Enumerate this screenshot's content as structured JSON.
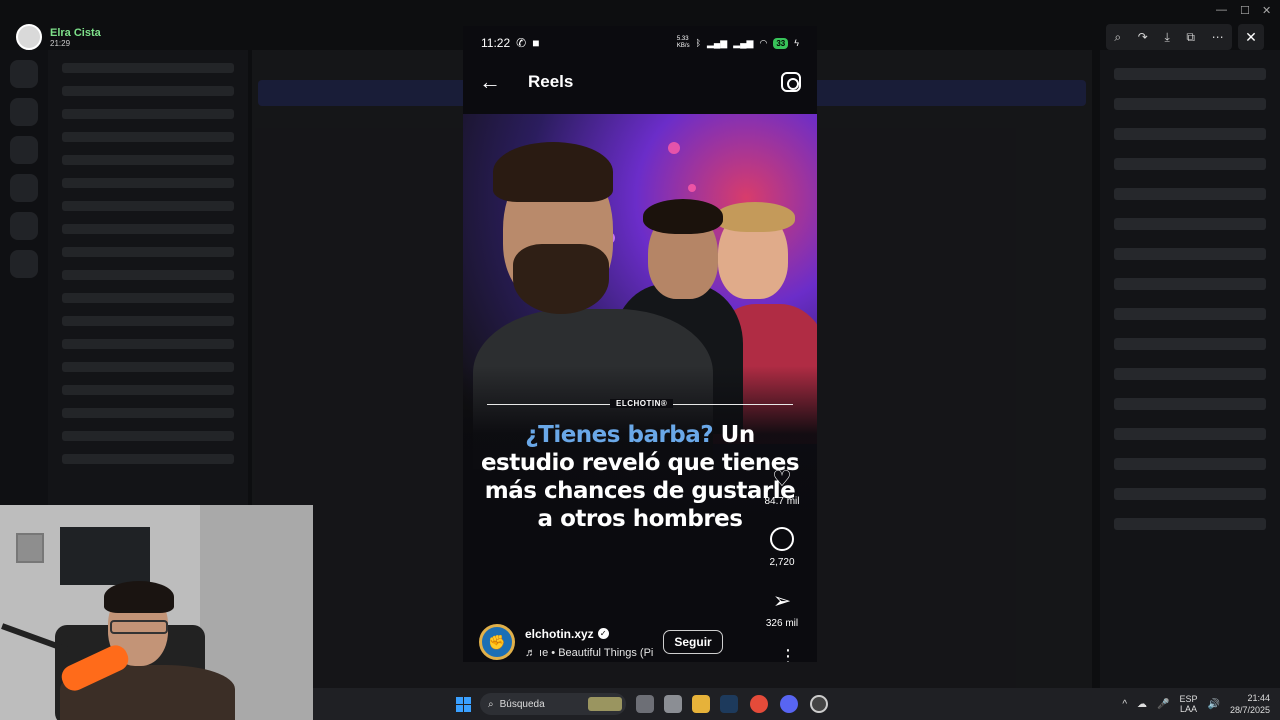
{
  "user": {
    "name": "Elra Cista",
    "time": "21:29"
  },
  "viewer": {
    "tools": [
      "⌕",
      "↷",
      "⤓",
      "⧉",
      "⋯"
    ],
    "close": "✕",
    "window_controls": [
      "—",
      "☐",
      "✕"
    ]
  },
  "phone": {
    "status": {
      "time": "11:22",
      "speed": "5.33\nKB/s",
      "battery": "33"
    },
    "header": {
      "title": "Reels"
    },
    "reel": {
      "brand": "ELCHOTIN®",
      "headline_accent": "¿Tienes barba?",
      "headline_rest": " Un estudio reveló que tienes más chances de gustarle a otros hombres"
    },
    "actions": {
      "likes": "84.7 mil",
      "comments": "2,720",
      "shares": "326 mil"
    },
    "author": {
      "name": "elchotin.xyz",
      "music": "♬ ıe • Beautiful Things (Pi",
      "follow_label": "Seguir"
    }
  },
  "taskbar": {
    "search_placeholder": "Búsqueda",
    "lang_top": "ESP",
    "lang_bottom": "LAA",
    "clock_time": "21:44",
    "clock_date": "28/7/2025",
    "tray_arrow": "^",
    "tray_icons": [
      "☁",
      "🎤",
      "🔊"
    ]
  },
  "colors": {
    "accent_blue": "#6aa8e8",
    "online_green": "#7ee08a",
    "battery_green": "#38c35a"
  }
}
